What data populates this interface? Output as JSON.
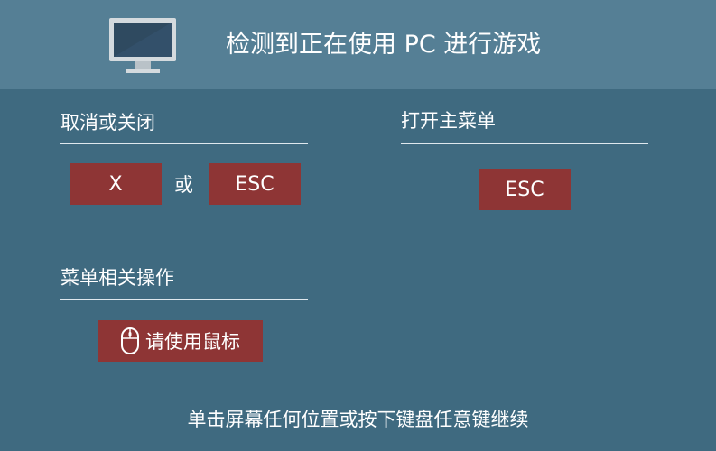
{
  "header": {
    "title": "检测到正在使用 PC 进行游戏",
    "icon": "monitor-icon"
  },
  "close_section": {
    "title": "取消或关闭",
    "key_x": "X",
    "or_label": "或",
    "key_esc": "ESC"
  },
  "menu_section": {
    "title": "打开主菜单",
    "key_esc": "ESC"
  },
  "menu_ops_section": {
    "title": "菜单相关操作",
    "mouse_label": "请使用鼠标",
    "icon": "mouse-icon"
  },
  "footer": {
    "text": "单击屏幕任何位置或按下键盘任意键继续"
  },
  "colors": {
    "background": "#3f6a80",
    "header": "#557f95",
    "key": "#8e3535",
    "text": "#ffffff"
  }
}
